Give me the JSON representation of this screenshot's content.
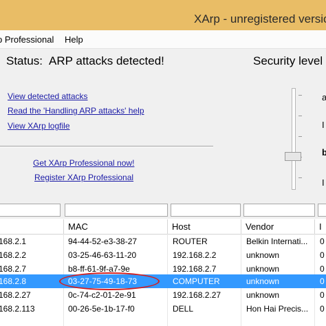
{
  "window": {
    "title": "XArp - unregistered version"
  },
  "menu": {
    "items": [
      {
        "label": "p Professional"
      },
      {
        "label": "Help"
      }
    ]
  },
  "status": {
    "label": "Status:",
    "message": "ARP attacks detected!",
    "security_label": "Security level s"
  },
  "links": {
    "view_attacks": "View detected attacks",
    "read_handling": "Read the 'Handling ARP attacks' help",
    "view_logfile": "View XArp logfile",
    "get_pro": "Get XArp Professional now!",
    "register_pro": "Register XArp Professional"
  },
  "right_panel": {
    "letters": [
      "a",
      "I",
      "b",
      "I"
    ]
  },
  "table": {
    "columns": [
      "MAC",
      "Host",
      "Vendor",
      "I"
    ],
    "rows": [
      {
        "ip": "168.2.1",
        "mac": "94-44-52-e3-38-27",
        "host": "ROUTER",
        "vendor": "Belkin Internati...",
        "iface": "0"
      },
      {
        "ip": "168.2.2",
        "mac": "03-25-46-63-11-20",
        "host": "192.168.2.2",
        "vendor": "unknown",
        "iface": "0"
      },
      {
        "ip": "168.2.7",
        "mac": "b8-ff-61-9f-a7-9e",
        "host": "192.168.2.7",
        "vendor": "unknown",
        "iface": "0"
      },
      {
        "ip": "168.2.8",
        "mac": "03-27-75-49-18-73",
        "host": "COMPUTER",
        "vendor": "unknown",
        "iface": "0",
        "selected": true
      },
      {
        "ip": "168.2.27",
        "mac": "0c-74-c2-01-2e-91",
        "host": "192.168.2.27",
        "vendor": "unknown",
        "iface": "0"
      },
      {
        "ip": "168.2.113",
        "mac": "00-26-5e-1b-17-f0",
        "host": "DELL",
        "vendor": "Hon Hai Precis...",
        "iface": "0"
      }
    ]
  },
  "colors": {
    "titlebar": "#e9bd66",
    "selection": "#3399ff",
    "link": "#1a1aa6",
    "highlight_circle": "#d21f1f"
  }
}
